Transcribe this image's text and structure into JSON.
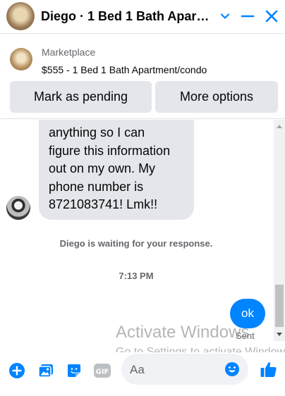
{
  "header": {
    "title": "Diego · 1 Bed 1 Bath Apart…",
    "buttons": [
      "chevron-down-icon",
      "minimize-icon",
      "close-icon"
    ]
  },
  "marketplace": {
    "label": "Marketplace",
    "item": "$555 - 1 Bed 1 Bath Apartment/condo",
    "mark_pending": "Mark as pending",
    "more_options": "More options"
  },
  "chat": {
    "incoming_lines": [
      "anything so I can",
      "figure this information",
      "out on my own. My",
      "phone number is",
      "8721083741! Lmk!!"
    ],
    "waiting": "Diego is waiting for your response.",
    "time": "7:13 PM",
    "outgoing": "ok",
    "status": "Sent"
  },
  "watermark": {
    "line1": "Activate Windows",
    "line2": "Go to Settings to activate Windows."
  },
  "composer": {
    "placeholder": "Aa",
    "icons": [
      "plus-circle-icon",
      "photo-icon",
      "sticker-icon",
      "gif-icon",
      "emoji-icon",
      "like-icon"
    ]
  },
  "colors": {
    "accent": "#0084ff",
    "bubble_gray": "#e4e6eb",
    "secondary_text": "#65676b"
  }
}
